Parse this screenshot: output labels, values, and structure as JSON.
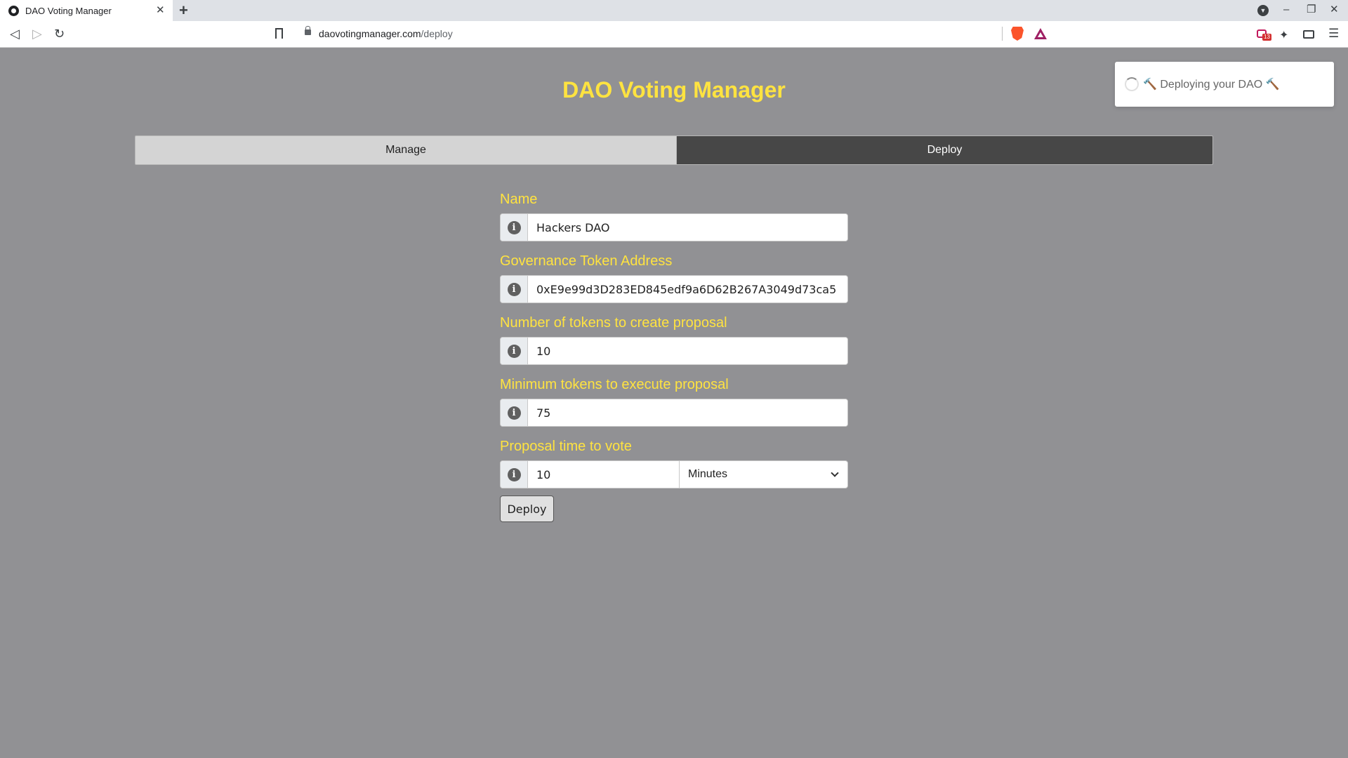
{
  "browser": {
    "tab_title": "DAO Voting Manager",
    "tab_close": "✕",
    "new_tab": "+",
    "url_host": "daovotingmanager.com",
    "url_path": "/deploy",
    "extension_badge": "13",
    "window_minimize": "‒",
    "window_restore": "❐",
    "window_close": "✕"
  },
  "page": {
    "title": "DAO Voting Manager",
    "tabs": [
      {
        "label": "Manage",
        "active": false
      },
      {
        "label": "Deploy",
        "active": true
      }
    ]
  },
  "form": {
    "name": {
      "label": "Name",
      "value": "Hackers DAO"
    },
    "token_address": {
      "label": "Governance Token Address",
      "value": "0xE9e99d3D283ED845edf9a6D62B267A3049d73ca5"
    },
    "tokens_to_create": {
      "label": "Number of tokens to create proposal",
      "value": "10"
    },
    "min_tokens_execute": {
      "label": "Minimum tokens to execute proposal",
      "value": "75"
    },
    "time_to_vote": {
      "label": "Proposal time to vote",
      "value": "10",
      "unit": "Minutes"
    },
    "deploy_label": "Deploy"
  },
  "toast": {
    "message": "🔨 Deploying your DAO 🔨"
  },
  "colors": {
    "background": "#919194",
    "accent_yellow": "#ffe340",
    "active_tab": "#474747",
    "inactive_tab": "#d4d4d4"
  }
}
